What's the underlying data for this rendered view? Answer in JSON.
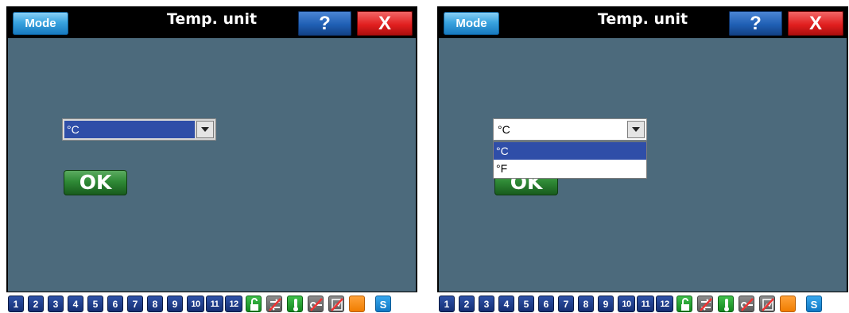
{
  "screens": [
    {
      "title": "Temp. unit",
      "mode_label": "Mode",
      "help_label": "?",
      "close_label": "X",
      "select_value": "°C",
      "ok_label": "OK",
      "dropdown_open": false
    },
    {
      "title": "Temp. unit",
      "mode_label": "Mode",
      "help_label": "?",
      "close_label": "X",
      "select_value": "°C",
      "ok_label": "OK",
      "dropdown_open": true,
      "dropdown_options": [
        "°C",
        "°F"
      ],
      "highlighted_option": "°C"
    }
  ],
  "taskbar": {
    "numbers": [
      "1",
      "2",
      "3",
      "4",
      "5",
      "6",
      "7",
      "8",
      "9",
      "10",
      "11",
      "12"
    ],
    "icons": [
      "unlock-icon",
      "sync-disabled-icon",
      "thermometer-icon",
      "key-disabled-icon",
      "chart-disabled-icon",
      "orange-status-icon",
      "s-icon"
    ],
    "s_label": "S"
  },
  "colors": {
    "background": "#4c6a7c",
    "title_bar": "#000000",
    "selection": "#2f4ea8",
    "ok_green": "#2f8a36",
    "close_red": "#e21f1f",
    "help_blue": "#1f5fb4",
    "mode_blue": "#3aa4e0"
  }
}
